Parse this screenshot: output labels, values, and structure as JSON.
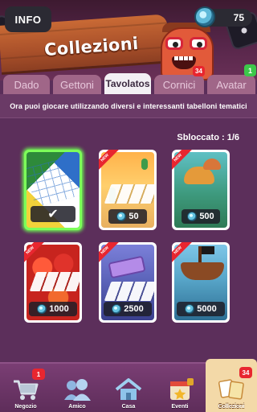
{
  "header": {
    "info_label": "INFO",
    "gems": "75",
    "title": "Collezioni",
    "mascot_badge": "34"
  },
  "tabs": [
    {
      "label": "Dado",
      "active": false
    },
    {
      "label": "Gettoni",
      "active": false
    },
    {
      "label": "Tavolatos",
      "active": true
    },
    {
      "label": "Cornici",
      "active": false
    },
    {
      "label": "Avatar",
      "active": false
    }
  ],
  "tab_badge": "1",
  "banner": "Ora puoi giocare utilizzando diversi e interessanti tabelloni tematici",
  "unlocked": "Sbloccato : 1/6",
  "cards": [
    {
      "theme": "classic-ludo",
      "price": "",
      "selected": true,
      "new": false,
      "owned": true
    },
    {
      "theme": "desert",
      "price": "50",
      "selected": false,
      "new": true,
      "owned": false
    },
    {
      "theme": "jungle",
      "price": "500",
      "selected": false,
      "new": true,
      "owned": false
    },
    {
      "theme": "fruit",
      "price": "1000",
      "selected": false,
      "new": true,
      "owned": false
    },
    {
      "theme": "ocean",
      "price": "2500",
      "selected": false,
      "new": true,
      "owned": false
    },
    {
      "theme": "pirate",
      "price": "5000",
      "selected": false,
      "new": true,
      "owned": false
    }
  ],
  "new_ribbon": "NEW",
  "nav": [
    {
      "label": "Negozio",
      "icon": "cart-icon",
      "badge": "1"
    },
    {
      "label": "Amico",
      "icon": "friends-icon",
      "badge": ""
    },
    {
      "label": "Casa",
      "icon": "home-icon",
      "badge": ""
    },
    {
      "label": "Eventi",
      "icon": "events-icon",
      "badge": ""
    },
    {
      "label": "Collezioni",
      "icon": "collections-icon",
      "badge": "34",
      "active": true
    }
  ],
  "colors": {
    "background": "#5c2f5b",
    "tab_inactive": "#a06688",
    "tab_active": "#f3f0f4",
    "selected_glow": "#7dff5a",
    "badge_red": "#e8262f",
    "badge_green": "#3cc84a"
  }
}
